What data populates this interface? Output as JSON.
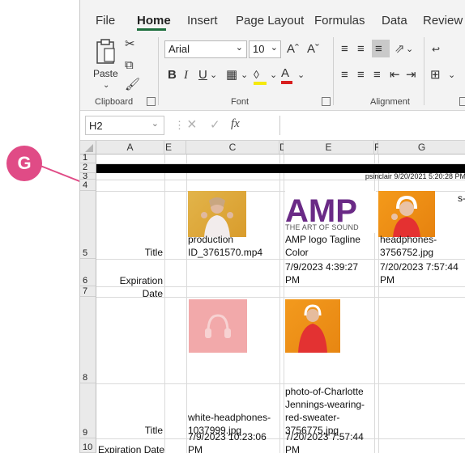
{
  "ribbon": {
    "tabs": [
      "File",
      "Home",
      "Insert",
      "Page Layout",
      "Formulas",
      "Data",
      "Review"
    ],
    "active_tab": "Home",
    "paste_label": "Paste",
    "font_name": "Arial",
    "font_size": "10",
    "groups": [
      "Clipboard",
      "Font",
      "Alignment"
    ]
  },
  "formula_bar": {
    "name_box": "H2",
    "fx_label": "fx",
    "content": ""
  },
  "grid": {
    "columns": [
      "A",
      "E",
      "C",
      "D",
      "E",
      "F",
      "G"
    ],
    "rows": [
      "1",
      "2",
      "3",
      "4",
      "5",
      "6",
      "7",
      "8",
      "9",
      "10"
    ],
    "header_text": "psinclair 9/20/2021 5:20:28 PM",
    "r5_a": "Title",
    "r5_c": "production ID_3761570.mp4",
    "r5_e": "AMP logo Tagline Color",
    "r5_g": "headphones-3756752.jpg",
    "r4_g_frag": "s-",
    "r6_a": "Expiration Date",
    "r6_e": "7/9/2023 4:39:27 PM",
    "r6_g": "7/20/2023 7:57:44 PM",
    "r9_a": "Title",
    "r9_c": "white-headphones-1037999.jpg",
    "r9_e": "photo-of-Charlotte Jennings-wearing-red-sweater-3756775.jpg",
    "r10_a": "Expiration Date",
    "r10_c": "7/9/2023 10:23:06 PM",
    "r10_e": "7/20/2023 7:57:44 PM",
    "amp_tagline": "THE ART OF SOUND",
    "amp_logo": "AMP"
  },
  "annotation": {
    "callout_letter": "G"
  },
  "colors": {
    "accent": "#1e6e3d",
    "callout": "#e04b86",
    "banner": "#000000",
    "amp_purple": "#6a2a86"
  }
}
